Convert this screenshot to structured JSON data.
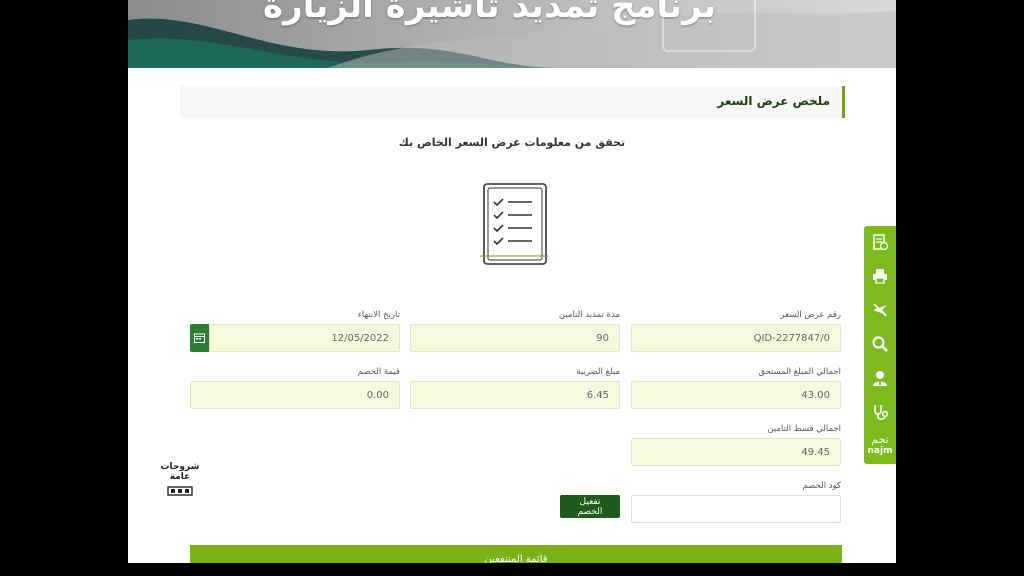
{
  "banner": {
    "title": "برنامج تمديد تأشيرة الزيارة"
  },
  "section": {
    "title": "ملخص عرض السعر"
  },
  "subtitle": "تحقق من معلومات عرض السعر الخاص بك",
  "fields": {
    "quote_number": {
      "label": "رقم عرض السعر",
      "value": "QID-2277847/0"
    },
    "extension_period": {
      "label": "مدة تمديد التامين",
      "value": "90"
    },
    "end_date": {
      "label": "تاريخ الانتهاء",
      "value": "12/05/2022"
    },
    "total_due": {
      "label": "اجمالي المبلغ المستحق",
      "value": "43.00"
    },
    "tax_amount": {
      "label": "مبلغ الضريبة",
      "value": "6.45"
    },
    "discount_value": {
      "label": "قيمة الخصم",
      "value": "0.00"
    },
    "total_premium": {
      "label": "اجمالي قسط التامين",
      "value": "49.45"
    },
    "discount_code": {
      "label": "كود الخصم",
      "value": ""
    }
  },
  "buttons": {
    "activate_discount": "تفعيل الخصم"
  },
  "beneficiaries": {
    "label": "قائمة المنتفعين"
  },
  "sidebar": {
    "items": [
      "document-icon",
      "printer-icon",
      "plane-icon",
      "search-icon",
      "doctor-icon",
      "stethoscope-icon"
    ],
    "najm_ar": "نجم",
    "najm_en": "najm"
  },
  "floating": {
    "line1": "شروحات",
    "line2": "عامة"
  },
  "colors": {
    "accent": "#7cbb1e",
    "field_bg": "#f4fbdc",
    "dark_green": "#1f5b1a"
  }
}
